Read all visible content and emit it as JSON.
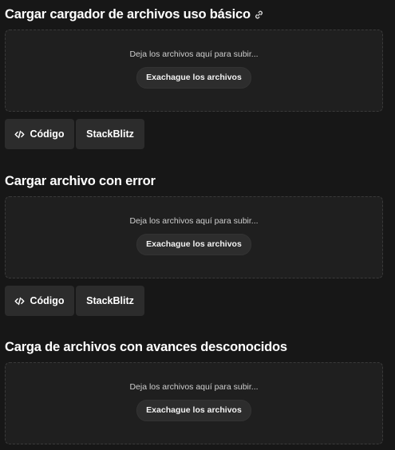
{
  "sections": [
    {
      "title": "Cargar cargador de archivos uso básico",
      "has_link_icon": true,
      "drop_text": "Deja los archivos aquí para subir...",
      "browse_label": "Exachague los archivos",
      "code_label": "Código",
      "stackblitz_label": "StackBlitz"
    },
    {
      "title": "Cargar archivo con error",
      "drop_text": "Deja los archivos aquí para subir...",
      "browse_label": "Exachague los archivos",
      "code_label": "Código",
      "stackblitz_label": "StackBlitz"
    },
    {
      "title": "Carga de archivos con avances desconocidos",
      "drop_text": "Deja los archivos aquí para subir...",
      "browse_label": "Exachague los archivos"
    }
  ],
  "icons": {
    "link": "link-icon",
    "code": "code-icon"
  },
  "colors": {
    "background": "#171717",
    "dropzone": "#1f1f1f",
    "button": "#2c2c2c",
    "text": "#ffffff"
  }
}
